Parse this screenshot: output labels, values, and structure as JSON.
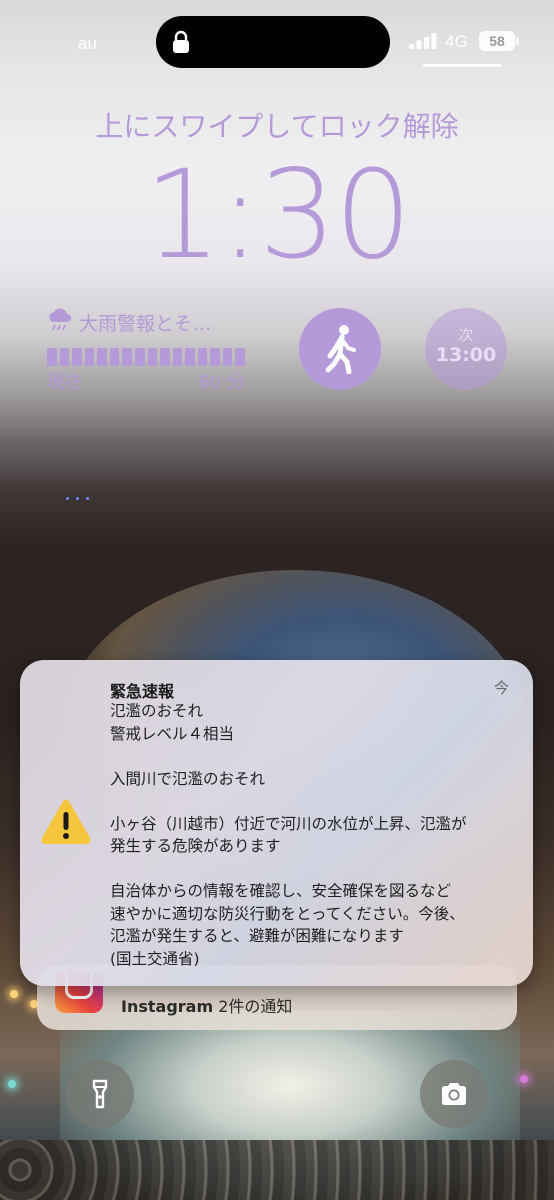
{
  "status_bar": {
    "carrier": "au",
    "network": "4G",
    "battery": "58"
  },
  "lock_screen": {
    "unlock_hint": "上にスワイプしてロック解除",
    "time": "1:30"
  },
  "widgets": {
    "weather": {
      "icon": "rain-cloud-icon",
      "title": "大雨警報とそ…",
      "start_label": "現在",
      "end_label": "60 分"
    },
    "fitness": {
      "icon": "walking-icon"
    },
    "next": {
      "label": "次",
      "time": "13:00"
    }
  },
  "notifications": {
    "alert": {
      "icon": "warning-icon",
      "title": "緊急速報",
      "time": "今",
      "lines": [
        "氾濫のおそれ",
        "警戒レベル４相当",
        "",
        "入間川で氾濫のおそれ",
        "",
        "小ヶ谷（川越市）付近で河川の水位が上昇、氾濫が",
        "発生する危険があります",
        "",
        "自治体からの情報を確認し、安全確保を図るなど",
        "速やかに適切な防災行動をとってください。今後、",
        "氾濫が発生すると、避難が困難になります",
        "(国土交通省)"
      ]
    },
    "instagram": {
      "app": "Instagram",
      "summary": "2件の通知"
    }
  },
  "quick_actions": {
    "flashlight": "flashlight-icon",
    "camera": "camera-icon"
  },
  "colors": {
    "accent": "#b49ad8"
  }
}
